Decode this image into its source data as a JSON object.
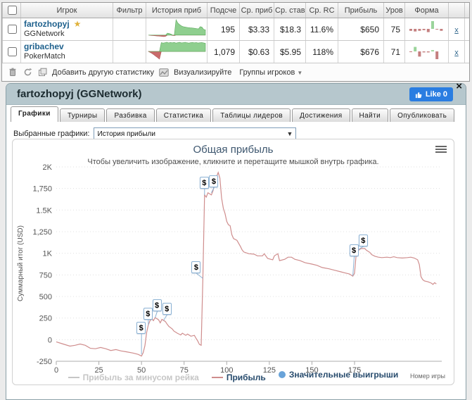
{
  "colors": {
    "accent_like": "#2a7de1",
    "panel_head": "#b6c7cd",
    "series_line": "#cf8d8d",
    "win_marker": "#69a3d9",
    "legend_text": "#274b6d",
    "player_link": "#1f618d"
  },
  "stats_table": {
    "headers": [
      "Игрок",
      "Фильтр",
      "История приб",
      "Подсче",
      "Ср. приб",
      "Ср. став",
      "Ср. RC",
      "Прибыль",
      "Уров",
      "Форма"
    ],
    "rows": [
      {
        "player": "fartozhopyj",
        "badge": "★",
        "network": "GGNetwork",
        "filter": "",
        "count": "195",
        "avg_profit": "$3.33",
        "avg_stake": "$18.3",
        "avg_rc": "11.6%",
        "profit": "$650",
        "level": "75",
        "remove": "x",
        "trend": [
          0,
          -30,
          -50,
          -70,
          -90,
          -110,
          -120,
          -140,
          -160,
          -190,
          -140,
          240,
          200,
          120,
          -40,
          -65,
          1900,
          1500,
          1300,
          1150,
          1050,
          1000,
          960,
          930,
          900,
          880,
          860,
          830,
          800,
          760,
          1040,
          980,
          700,
          650
        ],
        "form": [
          -3,
          -4,
          -3,
          -2,
          -5,
          12,
          0,
          -3
        ]
      },
      {
        "player": "gribachev",
        "badge": "",
        "network": "PokerMatch",
        "filter": "",
        "count": "1,079",
        "avg_profit": "$0.63",
        "avg_stake": "$5.95",
        "avg_rc": "118%",
        "profit": "$676",
        "level": "71",
        "remove": "x",
        "trend": [
          0,
          -60,
          -120,
          -200,
          -280,
          -360,
          -450,
          520,
          490,
          515,
          540,
          500,
          525,
          505,
          530,
          490,
          515,
          535,
          500,
          520,
          540,
          510,
          490,
          515,
          530,
          505,
          520,
          495,
          510,
          520,
          500,
          480
        ],
        "form": [
          -1,
          7,
          -8,
          -1.5,
          -1.5,
          2,
          -12
        ]
      }
    ],
    "toolbar": {
      "add_stat": "Добавить другую статистику",
      "visualize": "Визуализируйте",
      "groups": "Группы игроков"
    }
  },
  "panel": {
    "title": "fartozhopyj (GGNetwork)",
    "like_label": "Like 0",
    "close_glyph": "×",
    "tabs": [
      "Графики",
      "Турниры",
      "Разбивка",
      "Статистика",
      "Таблицы лидеров",
      "Достижения",
      "Найти",
      "Опубликовать"
    ],
    "active_tab_index": 0,
    "chart_select_label": "Выбранные графики:",
    "chart_select_value": "История прибыли"
  },
  "chart_data": {
    "type": "line",
    "title": "Общая прибыль",
    "subtitle": "Чтобы увеличить изображение, кликните и перетащите мышкой внутрь графика.",
    "ylabel": "Суммарный итог (USD)",
    "xlabel": "Номер игры",
    "ylim": [
      -250,
      2000
    ],
    "xlim": [
      0,
      228
    ],
    "grid": true,
    "legend_position": "bottom",
    "yticks": [
      {
        "v": 2000,
        "label": "2K"
      },
      {
        "v": 1750,
        "label": "1,750"
      },
      {
        "v": 1500,
        "label": "1.5K"
      },
      {
        "v": 1250,
        "label": "1,250"
      },
      {
        "v": 1000,
        "label": "1K"
      },
      {
        "v": 750,
        "label": "750"
      },
      {
        "v": 500,
        "label": "500"
      },
      {
        "v": 250,
        "label": "250"
      },
      {
        "v": 0,
        "label": "0"
      },
      {
        "v": -250,
        "label": "-250"
      }
    ],
    "xticks": [
      0,
      25,
      50,
      75,
      100,
      125,
      150,
      175
    ],
    "legend": [
      {
        "label": "Прибыль за минусом рейка",
        "color": "#c6c6c6",
        "text_color": "#c6c6c6",
        "marker": "line",
        "enabled": false
      },
      {
        "label": "Прибыль",
        "color": "#cf8d8d",
        "text_color": "#274b6d",
        "marker": "line",
        "enabled": true
      },
      {
        "label": "Значительные выигрыши",
        "color": "#69a3d9",
        "text_color": "#274b6d",
        "marker": "circle",
        "enabled": true
      }
    ],
    "series": [
      {
        "name": "Прибыль",
        "color": "#cf8d8d",
        "points": [
          [
            0,
            -25
          ],
          [
            4,
            -50
          ],
          [
            8,
            -75
          ],
          [
            11,
            -65
          ],
          [
            14,
            -50
          ],
          [
            17,
            -65
          ],
          [
            20,
            -100
          ],
          [
            23,
            -105
          ],
          [
            26,
            -90
          ],
          [
            29,
            -105
          ],
          [
            32,
            -125
          ],
          [
            35,
            -115
          ],
          [
            38,
            -130
          ],
          [
            41,
            -140
          ],
          [
            45,
            -155
          ],
          [
            48,
            -170
          ],
          [
            50,
            -190
          ],
          [
            51,
            -150
          ],
          [
            52,
            -70
          ],
          [
            53,
            80
          ],
          [
            54,
            170
          ],
          [
            55,
            220
          ],
          [
            56,
            245
          ],
          [
            57,
            220
          ],
          [
            58,
            255
          ],
          [
            60,
            230
          ],
          [
            61,
            195
          ],
          [
            62,
            235
          ],
          [
            64,
            210
          ],
          [
            65,
            180
          ],
          [
            66,
            155
          ],
          [
            68,
            125
          ],
          [
            69,
            100
          ],
          [
            71,
            75
          ],
          [
            73,
            55
          ],
          [
            74,
            75
          ],
          [
            76,
            50
          ],
          [
            77,
            65
          ],
          [
            79,
            40
          ],
          [
            81,
            50
          ],
          [
            82,
            15
          ],
          [
            83,
            -15
          ],
          [
            84,
            -55
          ],
          [
            85,
            -65
          ],
          [
            86,
            710
          ],
          [
            87,
            1675
          ],
          [
            88,
            1650
          ],
          [
            89,
            1700
          ],
          [
            91,
            1675
          ],
          [
            92,
            1725
          ],
          [
            93,
            1830
          ],
          [
            95,
            1935
          ],
          [
            96,
            1870
          ],
          [
            97,
            1640
          ],
          [
            98,
            1520
          ],
          [
            99,
            1460
          ],
          [
            100,
            1370
          ],
          [
            101,
            1330
          ],
          [
            102,
            1320
          ],
          [
            103,
            1215
          ],
          [
            104,
            1170
          ],
          [
            106,
            1150
          ],
          [
            108,
            1080
          ],
          [
            109,
            1040
          ],
          [
            110,
            1015
          ],
          [
            113,
            995
          ],
          [
            116,
            990
          ],
          [
            118,
            970
          ],
          [
            121,
            970
          ],
          [
            122,
            995
          ],
          [
            124,
            940
          ],
          [
            127,
            925
          ],
          [
            128,
            970
          ],
          [
            130,
            995
          ],
          [
            131,
            915
          ],
          [
            134,
            930
          ],
          [
            136,
            955
          ],
          [
            138,
            955
          ],
          [
            140,
            930
          ],
          [
            143,
            915
          ],
          [
            146,
            890
          ],
          [
            150,
            875
          ],
          [
            153,
            860
          ],
          [
            156,
            835
          ],
          [
            160,
            820
          ],
          [
            164,
            800
          ],
          [
            167,
            785
          ],
          [
            169,
            775
          ],
          [
            172,
            760
          ],
          [
            174,
            735
          ],
          [
            175,
            770
          ],
          [
            176,
            995
          ],
          [
            177,
            1030
          ],
          [
            178,
            1045
          ],
          [
            179,
            1055
          ],
          [
            181,
            1055
          ],
          [
            182,
            1035
          ],
          [
            184,
            1010
          ],
          [
            185,
            985
          ],
          [
            187,
            965
          ],
          [
            189,
            955
          ],
          [
            191,
            950
          ],
          [
            194,
            955
          ],
          [
            196,
            950
          ],
          [
            198,
            960
          ],
          [
            200,
            950
          ],
          [
            203,
            945
          ],
          [
            206,
            950
          ],
          [
            208,
            955
          ],
          [
            210,
            945
          ],
          [
            212,
            925
          ],
          [
            213,
            870
          ],
          [
            214,
            730
          ],
          [
            215,
            695
          ],
          [
            216,
            680
          ],
          [
            218,
            670
          ],
          [
            220,
            655
          ],
          [
            221,
            640
          ],
          [
            222,
            660
          ],
          [
            223,
            645
          ]
        ]
      }
    ],
    "significant_wins": [
      {
        "game": 50,
        "value": -170
      },
      {
        "game": 54,
        "value": 170
      },
      {
        "game": 58,
        "value": 255
      },
      {
        "game": 63,
        "value": 225
      },
      {
        "game": 86,
        "value": 710
      },
      {
        "game": 87,
        "value": 1675
      },
      {
        "game": 91,
        "value": 1700
      },
      {
        "game": 174,
        "value": 740
      },
      {
        "game": 177,
        "value": 1040
      }
    ]
  }
}
